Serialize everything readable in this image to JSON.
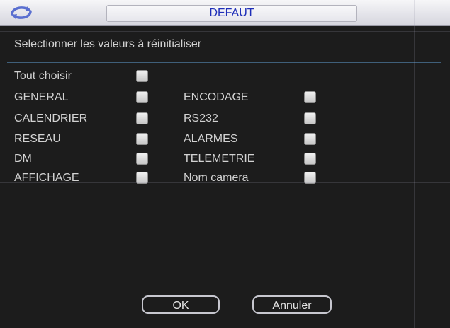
{
  "window": {
    "title": "DEFAUT",
    "subtitle": "Selectionner les valeurs à réinitialiser"
  },
  "options": {
    "select_all": {
      "label": "Tout choisir",
      "checked": false
    },
    "left": [
      {
        "label": "GENERAL",
        "checked": false
      },
      {
        "label": "CALENDRIER",
        "checked": false
      },
      {
        "label": "RESEAU",
        "checked": false
      },
      {
        "label": "DM",
        "checked": false
      },
      {
        "label": "AFFICHAGE",
        "checked": false
      }
    ],
    "right": [
      {
        "label": "ENCODAGE",
        "checked": false
      },
      {
        "label": "RS232",
        "checked": false
      },
      {
        "label": "ALARMES",
        "checked": false
      },
      {
        "label": "TELEMETRIE",
        "checked": false
      },
      {
        "label": "Nom camera",
        "checked": false
      }
    ]
  },
  "buttons": {
    "ok": "OK",
    "cancel": "Annuler"
  },
  "colors": {
    "title_text": "#1e2eb8",
    "background": "#1c1c1c",
    "text": "#d2d2d2"
  },
  "icons": {
    "logo": "refresh-swirl-icon",
    "checkbox": "checkbox-unchecked-icon"
  }
}
